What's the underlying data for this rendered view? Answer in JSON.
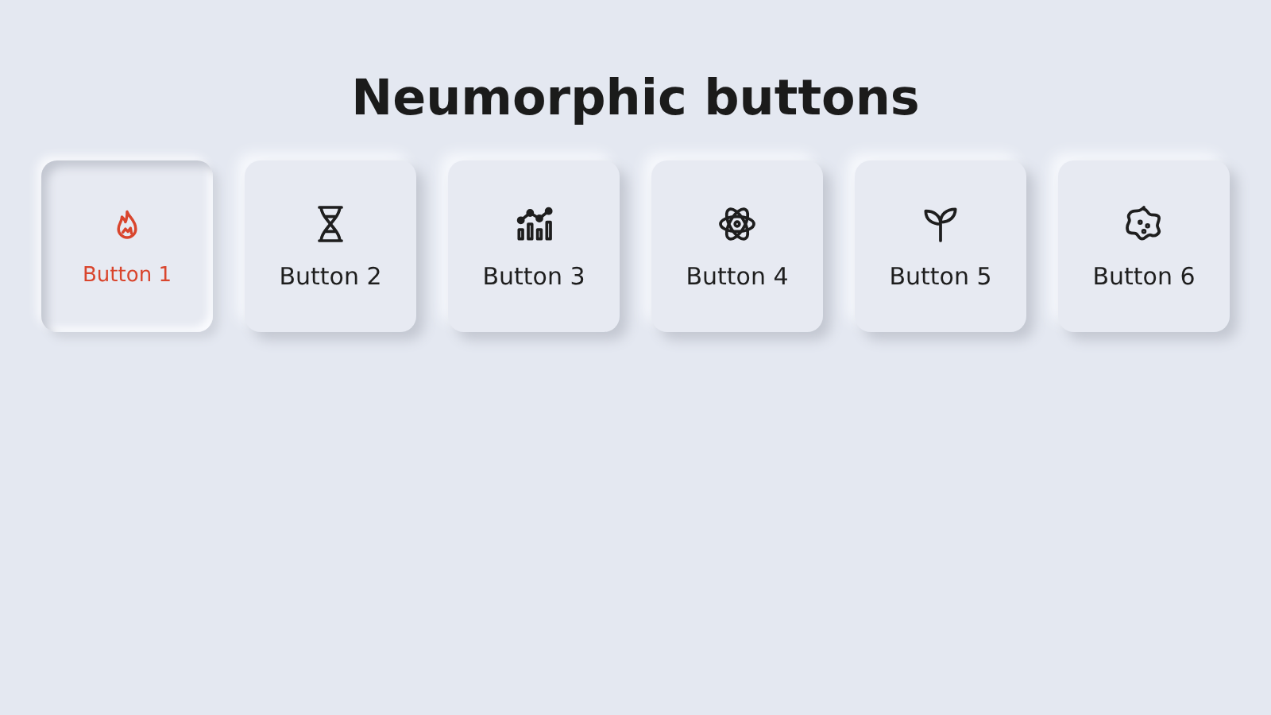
{
  "title": "Neumorphic buttons",
  "buttons": [
    {
      "label": "Button 1",
      "selected": true
    },
    {
      "label": "Button 2",
      "selected": false
    },
    {
      "label": "Button 3",
      "selected": false
    },
    {
      "label": "Button 4",
      "selected": false
    },
    {
      "label": "Button 5",
      "selected": false
    },
    {
      "label": "Button 6",
      "selected": false
    }
  ]
}
